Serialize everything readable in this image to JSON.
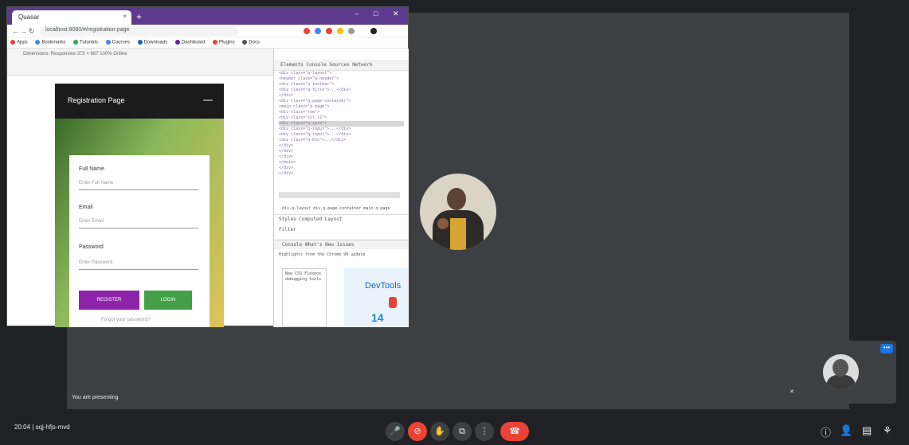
{
  "browser": {
    "tab_title": "Quasar",
    "tab_close": "×",
    "new_tab": "+",
    "url": "localhost:8080/#/registration-page",
    "bookmarks": [
      "Apps",
      "Bookmarks",
      "Tutorials",
      "Courses",
      "Downloads",
      "Dashboard",
      "Plugins",
      "Docs"
    ],
    "device_bar": "Dimensions: Responsive  375 × 667  100%  Online"
  },
  "app": {
    "header_title": "Registration Page",
    "field1_label": "Full Name",
    "field1_placeholder": "Enter Full Name",
    "field2_label": "Email",
    "field2_placeholder": "Enter Email",
    "field3_label": "Password",
    "field3_placeholder": "Enter Password",
    "primary_button": "REGISTER",
    "secondary_button": "LOGIN",
    "footer_link": "Forgot your password?"
  },
  "devtools": {
    "tabs": "Elements  Console  Sources  Network",
    "code_lines": [
      "<div class=\"q-layout\">",
      " <header class=\"q-header\">",
      "  <div class=\"q-toolbar\">",
      "   <div class=\"q-title\">...</div>",
      "  </div>",
      " <div class=\"q-page-container\">",
      "  <main class=\"q-page\">",
      "   <div class=\"row\">",
      "    <div class=\"col-12\">",
      "     <div class=\"q-card\">",
      "      <div class=\"q-input\">...</div>",
      "      <div class=\"q-input\">...</div>",
      "      <div class=\"q-btn\">...</div>",
      "     </div>",
      "    </div>",
      "   </div>",
      "  </main>",
      " </div>",
      "</div>"
    ],
    "breadcrumb": "div.q-layout  div.q-page-container  main.q-page",
    "filter_tabs": "Styles  Computed  Layout",
    "filter_placeholder": "Filter",
    "bottom_tabs": "Console  What's New  Issues",
    "hint": "Highlights from the Chrome 90 update",
    "panel_text": "New CSS Flexbox debugging tools",
    "promo_title": "DevTools",
    "promo_number": "14"
  },
  "meet": {
    "presenter_label": "You are presenting",
    "time": "20:04",
    "meeting_code": "sqj-hfjs-mvd",
    "self_more": "•••",
    "controls": {
      "mic": "🎤",
      "camera": "⊘",
      "hand": "✋",
      "present": "⧉",
      "more": "⋮",
      "end": "☎"
    },
    "right": {
      "info": "ⓘ",
      "people": "👤",
      "chat": "▤",
      "activities": "⚘"
    }
  }
}
